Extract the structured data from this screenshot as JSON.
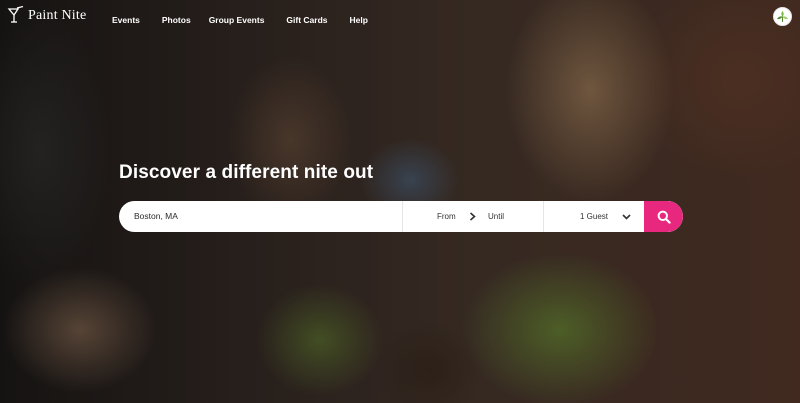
{
  "brand": {
    "name": "Paint Nite",
    "accent": "#e8287f"
  },
  "nav": {
    "items": [
      "Events",
      "Photos",
      "Group Events",
      "Gift Cards",
      "Help"
    ]
  },
  "hero": {
    "headline": "Discover a different nite out"
  },
  "search": {
    "location_value": "Boston, MA",
    "from_label": "From",
    "until_label": "Until",
    "guests_label": "1 Guest",
    "icons": {
      "arrow": "chevron-right-icon",
      "dropdown": "chevron-down-icon",
      "submit": "search-icon"
    }
  },
  "user": {
    "avatar_icon": "user-avatar-icon"
  }
}
